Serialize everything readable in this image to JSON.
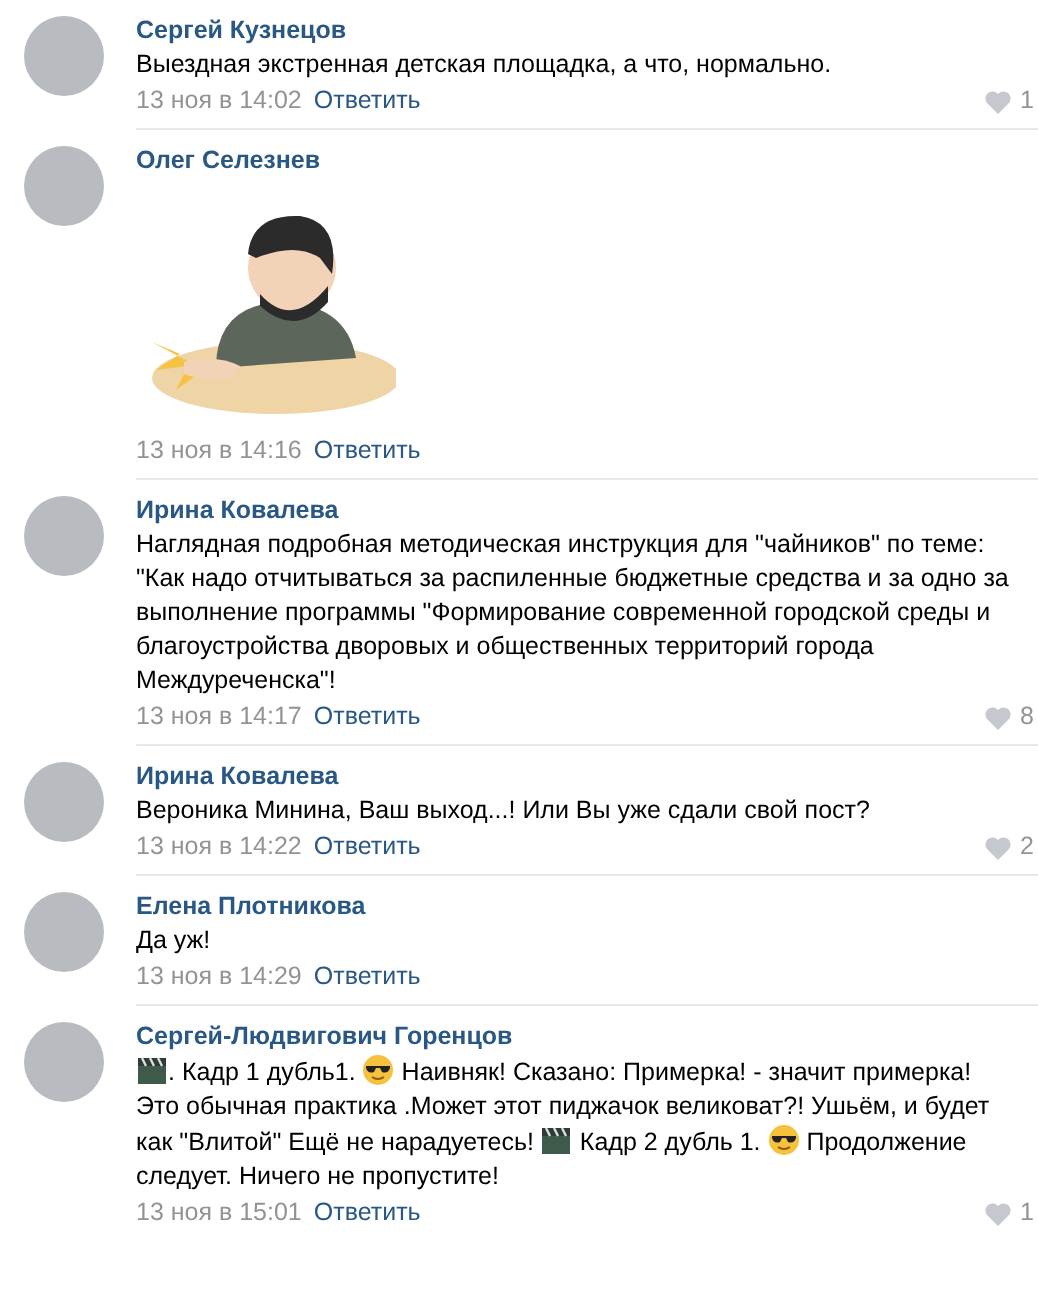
{
  "comments": [
    {
      "author": "Сергей Кузнецов",
      "body": [
        {
          "kind": "text",
          "text": "Выездная экстренная детская площадка, а что, нормально."
        }
      ],
      "date": "13 ноя в 14:02",
      "reply": "Ответить",
      "likes": "1"
    },
    {
      "author": "Олег Селезнев",
      "body": [
        {
          "kind": "sticker"
        }
      ],
      "date": "13 ноя в 14:16",
      "reply": "Ответить"
    },
    {
      "author": "Ирина Ковалева",
      "body": [
        {
          "kind": "text",
          "text": "Наглядная подробная методическая инструкция для \"чайников\" по теме: \"Как надо отчитываться за распиленные бюджетные средства и за одно за выполнение программы \"Формирование современной городской среды и благоустройства дворовых и общественных территорий города Междуреченска\"!"
        }
      ],
      "date": "13 ноя в 14:17",
      "reply": "Ответить",
      "likes": "8"
    },
    {
      "author": "Ирина Ковалева",
      "body": [
        {
          "kind": "text",
          "text": "Вероника Минина, Ваш выход...! Или Вы уже сдали свой пост?"
        }
      ],
      "date": "13 ноя в 14:22",
      "reply": "Ответить",
      "likes": "2"
    },
    {
      "author": "Елена Плотникова",
      "body": [
        {
          "kind": "text",
          "text": "Да уж!"
        }
      ],
      "date": "13 ноя в 14:29",
      "reply": "Ответить"
    },
    {
      "author": "Сергей-Людвигович Горенцов",
      "body": [
        {
          "kind": "clapper"
        },
        {
          "kind": "text",
          "text": ". Кадр 1 дубль1. "
        },
        {
          "kind": "sunglasses"
        },
        {
          "kind": "text",
          "text": " Наивняк! Сказано: Примерка! - значит примерка! Это обычная практика .Может этот пиджачок великоват?! Ушьём, и будет как \"Влитой\" Ещё не нарадуетесь! "
        },
        {
          "kind": "clapper"
        },
        {
          "kind": "text",
          "text": " Кадр 2 дубль 1. "
        },
        {
          "kind": "sunglasses"
        },
        {
          "kind": "text",
          "text": " Продолжение следует. Ничего не пропустите!"
        }
      ],
      "date": "13 ноя в 15:01",
      "reply": "Ответить",
      "likes": "1"
    }
  ]
}
